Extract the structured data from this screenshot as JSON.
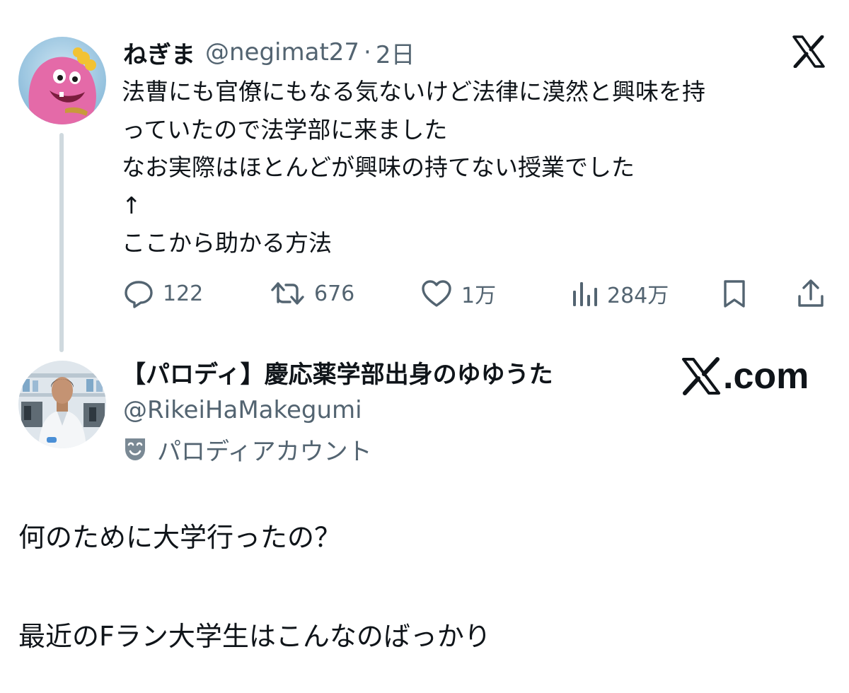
{
  "original_tweet": {
    "author_name": "ねぎま",
    "author_handle": "@negimat27",
    "separator": "·",
    "time": "2日",
    "text_lines": [
      "法曹にも官僚にもなる気ないけど法律に漠然と興味を持",
      "っていたので法学部に来ました",
      "なお実際はほとんどが興味の持てない授業でした",
      "↑",
      "ここから助かる方法"
    ],
    "actions": {
      "reply_count": "122",
      "retweet_count": "676",
      "like_count": "1万",
      "view_count": "284万"
    },
    "avatar_icon": "pink-puppet-avatar",
    "brand_icon": "x-logo-icon"
  },
  "reply_tweet": {
    "author_name": "【パロディ】慶応薬学部出身のゆゆうた",
    "author_handle": "@RikeiHaMakegumi",
    "label": "パロディアカウント",
    "label_icon": "theater-mask-icon",
    "avatar_icon": "lab-coat-person-avatar",
    "watermark": ".com",
    "text_paragraphs": [
      "何のために大学行ったの？",
      "最近のFラン大学生はこんなのばっかり"
    ]
  },
  "colors": {
    "text_primary": "#0f1419",
    "text_secondary": "#536471",
    "thread_line": "#cfd9de",
    "background": "#ffffff"
  }
}
